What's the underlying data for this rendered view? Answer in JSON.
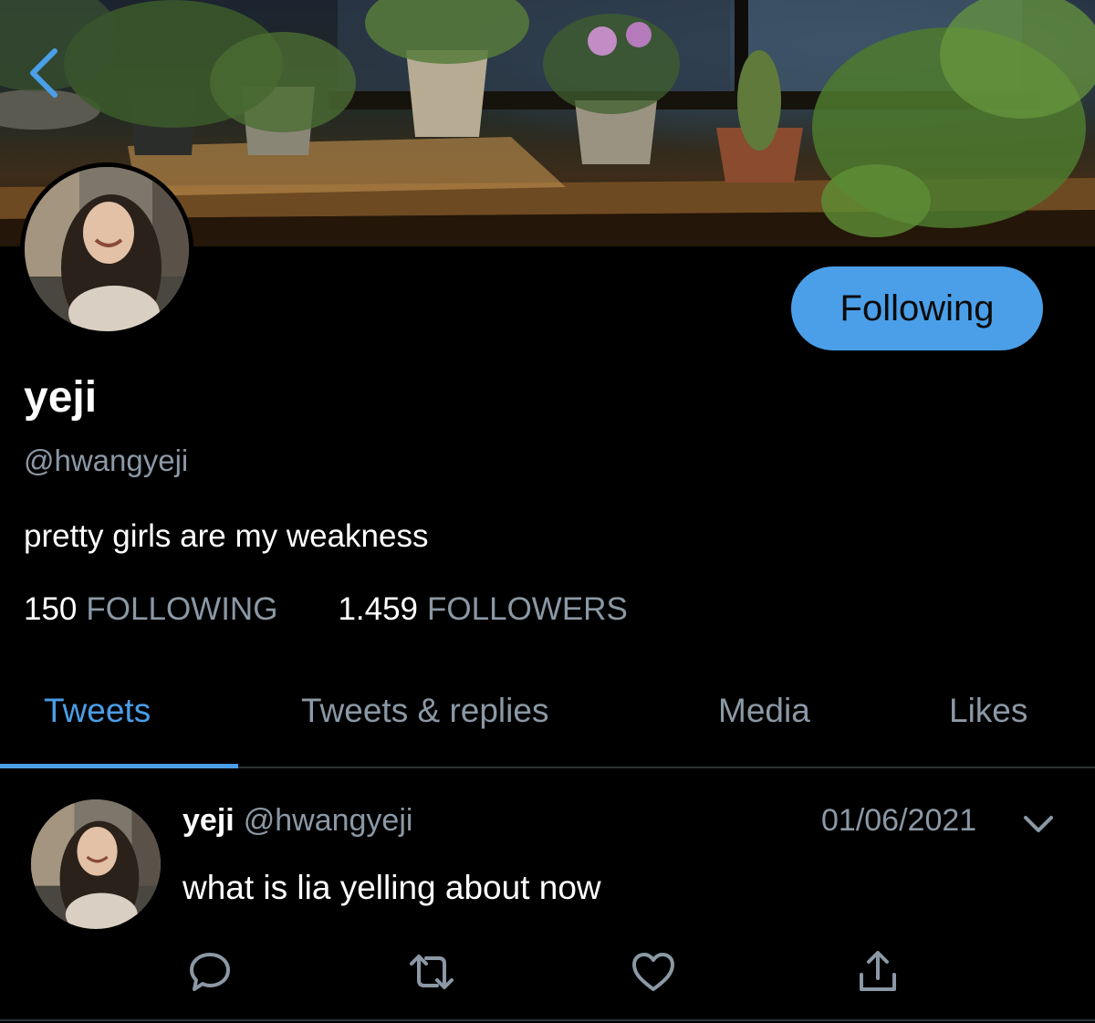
{
  "profile": {
    "display_name": "yeji",
    "handle": "@hwangyeji",
    "bio": "pretty girls are my weakness",
    "follow_button_label": "Following",
    "following_count": "150",
    "following_label": "FOLLOWING",
    "followers_count": "1.459",
    "followers_label": "FOLLOWERS"
  },
  "tabs": [
    {
      "label": "Tweets",
      "active": true
    },
    {
      "label": "Tweets & replies",
      "active": false
    },
    {
      "label": "Media",
      "active": false
    },
    {
      "label": "Likes",
      "active": false
    }
  ],
  "tweet": {
    "name": "yeji",
    "handle": "@hwangyeji",
    "date": "01/06/2021",
    "text": "what is lia yelling about now",
    "actions": [
      "reply-icon",
      "retweet-icon",
      "like-icon",
      "share-icon"
    ]
  },
  "colors": {
    "accent": "#4a9fe8",
    "muted": "#8b98a5",
    "background": "#000000"
  },
  "icons": {
    "back": "chevron-left-icon",
    "tweet_menu": "chevron-down-icon"
  }
}
